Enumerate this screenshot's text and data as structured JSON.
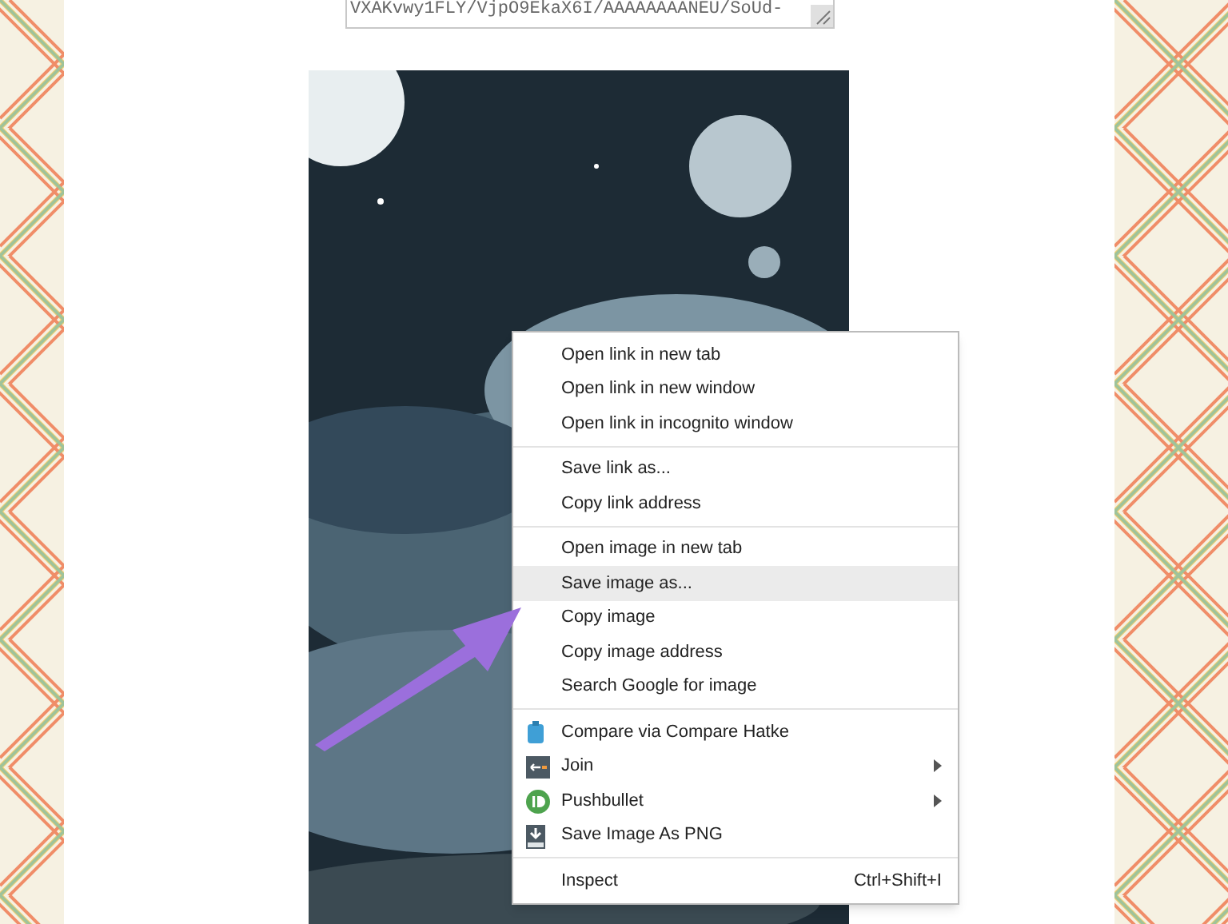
{
  "url_box": {
    "value": "VXAKvwy1FLY/VjpO9EkaX6I/AAAAAAAANEU/SoUd-"
  },
  "context_menu": {
    "groups": [
      [
        {
          "label": "Open link in new tab",
          "selected": false
        },
        {
          "label": "Open link in new window",
          "selected": false
        },
        {
          "label": "Open link in incognito window",
          "selected": false
        }
      ],
      [
        {
          "label": "Save link as...",
          "selected": false
        },
        {
          "label": "Copy link address",
          "selected": false
        }
      ],
      [
        {
          "label": "Open image in new tab",
          "selected": false
        },
        {
          "label": "Save image as...",
          "selected": true
        },
        {
          "label": "Copy image",
          "selected": false
        },
        {
          "label": "Copy image address",
          "selected": false
        },
        {
          "label": "Search Google for image",
          "selected": false
        }
      ],
      [
        {
          "label": "Compare via Compare Hatke",
          "selected": false,
          "kind": "hatke",
          "submenu": false
        },
        {
          "label": "Join",
          "selected": false,
          "kind": "join",
          "submenu": true
        },
        {
          "label": "Pushbullet",
          "selected": false,
          "kind": "pushbullet",
          "submenu": true
        },
        {
          "label": "Save Image As PNG",
          "selected": false,
          "kind": "png",
          "submenu": false
        }
      ],
      [
        {
          "label": "Inspect",
          "selected": false,
          "shortcut": "Ctrl+Shift+I"
        }
      ]
    ]
  }
}
